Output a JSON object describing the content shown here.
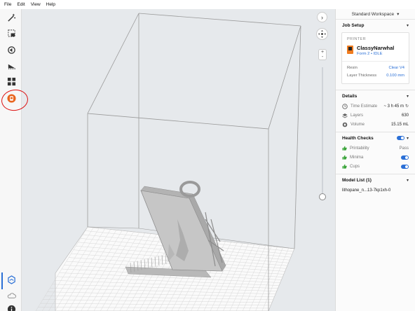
{
  "menu": {
    "file": "File",
    "edit": "Edit",
    "view": "View",
    "help": "Help"
  },
  "toolbar": {
    "icons": [
      "magic-wand-icon",
      "select-icon",
      "orient-icon",
      "supports-icon",
      "layout-icon",
      "print-icon"
    ],
    "bottom_icons": [
      "scene-icon",
      "cloud-icon",
      "info-icon"
    ]
  },
  "viewport": {
    "collapse_icon": "›",
    "zoom_in": "+",
    "zoom_out": "-"
  },
  "panel": {
    "workspace": "Standard Workspace",
    "job_setup": {
      "title": "Job Setup",
      "printer_caption": "PRINTER",
      "printer_name": "ClassyNarwhal",
      "printer_model": "Form 2 • IDLE",
      "resin_label": "Resin",
      "resin_value": "Clear V4",
      "layer_label": "Layer Thickness",
      "layer_value": "0.100 mm"
    },
    "details": {
      "title": "Details",
      "time_label": "Time Estimate",
      "time_value": "~ 3 h 45 m",
      "layers_label": "Layers",
      "layers_value": "630",
      "volume_label": "Volume",
      "volume_value": "15.15 mL"
    },
    "health": {
      "title": "Health Checks",
      "printability_label": "Printability",
      "printability_value": "Pass",
      "minima_label": "Minima",
      "cups_label": "Cups"
    },
    "models": {
      "title": "Model List (1)",
      "items": [
        "lithopane_n...13-7kp1xh-0"
      ]
    }
  },
  "colors": {
    "accent": "#2a6fd6",
    "printer_orange": "#f07c1f",
    "annotation": "#dd1111"
  }
}
